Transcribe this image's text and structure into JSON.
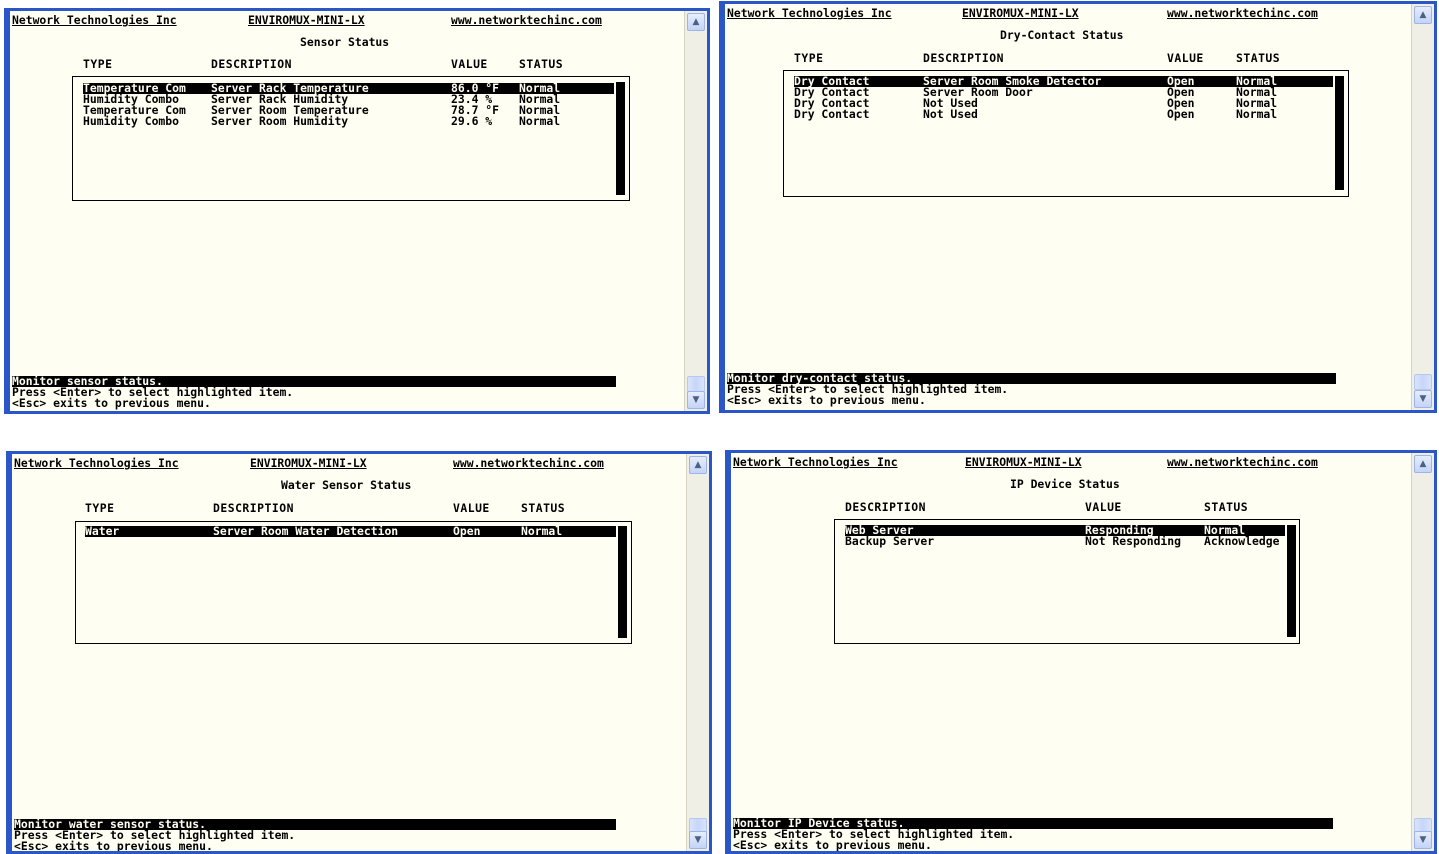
{
  "header": {
    "company": "Network Technologies Inc",
    "product": "ENVIROMUX-MINI-LX",
    "website": "www.networktechinc.com"
  },
  "footer": {
    "enter_hint": "Press <Enter> to select highlighted item.",
    "esc_hint": "<Esc> exits to previous menu."
  },
  "scrollbar": {
    "up_icon": "▲",
    "down_icon": "▼"
  },
  "sensor": {
    "title": "Sensor Status",
    "columns": {
      "type": "TYPE",
      "description": "DESCRIPTION",
      "value": "VALUE",
      "status": "STATUS"
    },
    "rows": [
      {
        "type": "Temperature Com",
        "description": "Server Rack Temperature",
        "value": "86.0 °F",
        "status": "Normal"
      },
      {
        "type": "Humidity Combo",
        "description": "Server Rack Humidity",
        "value": "23.4 %",
        "status": "Normal"
      },
      {
        "type": "Temperature Com",
        "description": "Server Room Temperature",
        "value": "78.7 °F",
        "status": "Normal"
      },
      {
        "type": "Humidity Combo",
        "description": "Server Room Humidity",
        "value": "29.6 %",
        "status": "Normal"
      }
    ],
    "status_line": "Monitor sensor status."
  },
  "dry": {
    "title": "Dry-Contact Status",
    "columns": {
      "type": "TYPE",
      "description": "DESCRIPTION",
      "value": "VALUE",
      "status": "STATUS"
    },
    "rows": [
      {
        "type": "Dry Contact",
        "description": "Server Room Smoke Detector",
        "value": "Open",
        "status": "Normal"
      },
      {
        "type": "Dry Contact",
        "description": "Server Room Door",
        "value": "Open",
        "status": "Normal"
      },
      {
        "type": "Dry Contact",
        "description": "Not Used",
        "value": "Open",
        "status": "Normal"
      },
      {
        "type": "Dry Contact",
        "description": "Not Used",
        "value": "Open",
        "status": "Normal"
      }
    ],
    "status_line": "Monitor dry-contact status."
  },
  "water": {
    "title": "Water Sensor Status",
    "columns": {
      "type": "TYPE",
      "description": "DESCRIPTION",
      "value": "VALUE",
      "status": "STATUS"
    },
    "rows": [
      {
        "type": "Water",
        "description": "Server Room Water Detection",
        "value": "Open",
        "status": "Normal"
      }
    ],
    "status_line": "Monitor water sensor status."
  },
  "ip": {
    "title": "IP Device Status",
    "columns": {
      "description": "DESCRIPTION",
      "value": "VALUE",
      "status": "STATUS"
    },
    "rows": [
      {
        "description": "Web Server",
        "value": "Responding",
        "status": "Normal"
      },
      {
        "description": "Backup Server",
        "value": "Not Responding",
        "status": "Acknowledge"
      }
    ],
    "status_line": "Monitor IP Device status."
  }
}
